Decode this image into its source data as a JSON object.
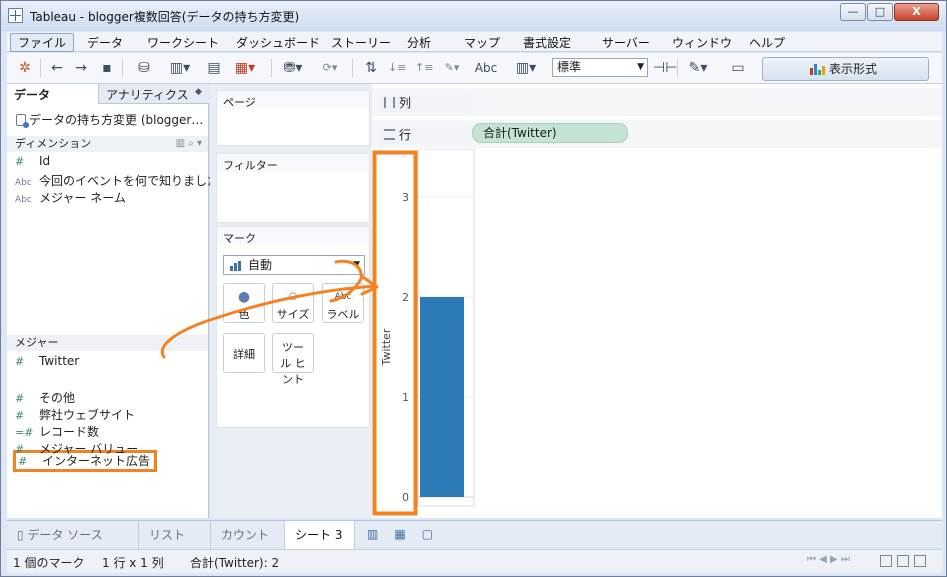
{
  "window": {
    "title": "Tableau - blogger複数回答(データの持ち方変更)",
    "min_label": "—",
    "max_label": "□",
    "close_label": "X"
  },
  "menu": [
    "ファイル",
    "データ",
    "ワークシート",
    "ダッシュボード",
    "ストーリー",
    "分析",
    "マップ",
    "書式設定",
    "サーバー",
    "ウィンドウ",
    "ヘルプ"
  ],
  "toolbar": {
    "abc_label": "Abc",
    "fit_value": "標準",
    "show_me_label": "表示形式"
  },
  "left_pane": {
    "tab_data": "データ",
    "tab_analytics": "アナリティクス",
    "datasource": "データの持ち方変更 (blogger…",
    "dimensions_header": "ディメンション",
    "dimensions": [
      {
        "type": "#",
        "name": "Id"
      },
      {
        "type": "Abc",
        "name": "今回のイベントを何で知りました…"
      },
      {
        "type": "Abc",
        "name": "メジャー ネーム"
      }
    ],
    "measures_header": "メジャー",
    "measures": [
      {
        "type": "#",
        "name": "Twitter"
      },
      {
        "type": "#",
        "name": "インターネット広告"
      },
      {
        "type": "#",
        "name": "その他"
      },
      {
        "type": "#",
        "name": "弊社ウェブサイト"
      },
      {
        "type": "=#",
        "name": "レコード数"
      },
      {
        "type": "#",
        "name": "メジャー バリュー"
      }
    ]
  },
  "shelves": {
    "pages": "ページ",
    "filters": "フィルター",
    "marks": "マーク",
    "mark_type": "自動",
    "mark_buttons": [
      {
        "name": "color",
        "label": "色"
      },
      {
        "name": "size",
        "label": "サイズ"
      },
      {
        "name": "label",
        "label": "ラベル"
      },
      {
        "name": "detail",
        "label": "詳細"
      },
      {
        "name": "tooltip",
        "label": "ツール ヒント"
      }
    ],
    "columns_label": "列",
    "rows_label": "行",
    "rows_pill": "合計(Twitter)"
  },
  "chart_data": {
    "type": "bar",
    "categories": [
      ""
    ],
    "values": [
      2
    ],
    "ylabel": "Twitter",
    "ylim": [
      0,
      3
    ],
    "yticks": [
      0,
      1,
      2,
      3
    ],
    "color": "#2c7bb6"
  },
  "colors": {
    "highlight": "#f58220",
    "bar": "#2c7bb6",
    "pill": "#c5e3d3"
  },
  "sheet_tabs": [
    "データ ソース",
    "リスト",
    "カウント",
    "シート 3"
  ],
  "status": {
    "marks": "1 個のマーク",
    "grid": "1 行 x 1 列",
    "sum": "合計(Twitter): 2"
  }
}
